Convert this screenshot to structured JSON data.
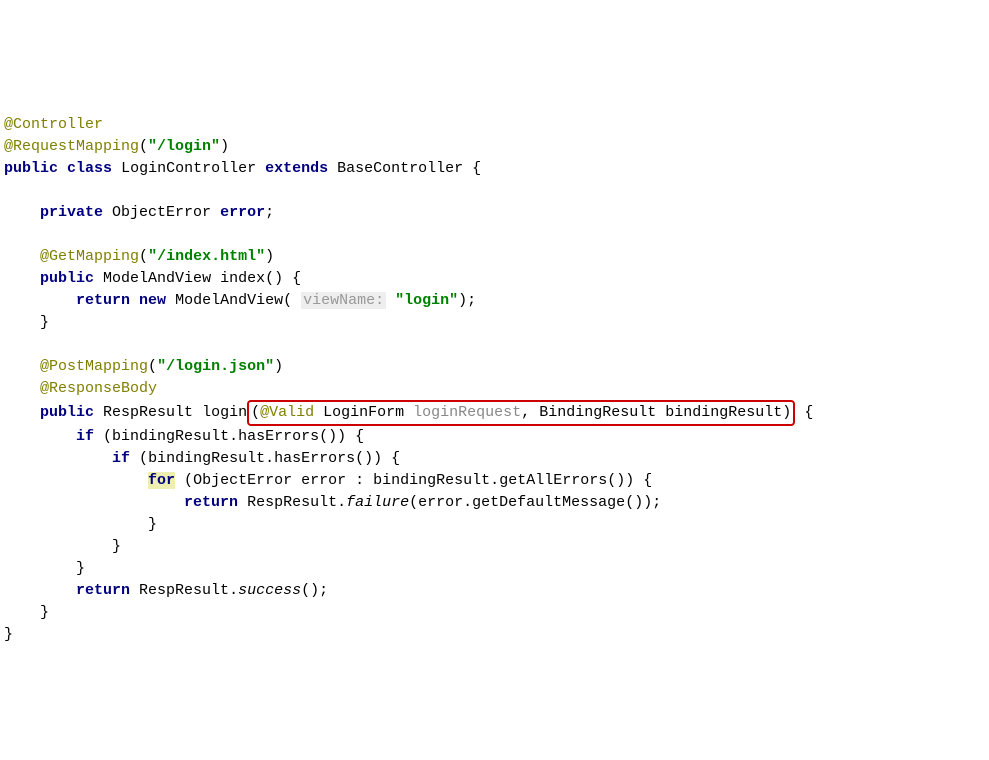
{
  "lines": {
    "at_controller": "@Controller",
    "at_requestmapping": "@RequestMapping",
    "login_path": "\"/login\"",
    "public": "public",
    "class_kw": "class",
    "extends_kw": "extends",
    "private_kw": "private",
    "return_kw": "return",
    "new_kw": "new",
    "if_kw": "if",
    "for_kw": "for",
    "login_controller": "LoginController",
    "base_controller": "BaseController",
    "object_error": "ObjectError",
    "error_field": "error",
    "at_getmapping": "@GetMapping",
    "index_path": "\"/index.html\"",
    "model_and_view": "ModelAndView",
    "index_method": "index",
    "viewname_hint": "viewName:",
    "login_str": "\"login\"",
    "at_postmapping": "@PostMapping",
    "login_json": "\"/login.json\"",
    "at_responsebody": "@ResponseBody",
    "resp_result": "RespResult",
    "login_method": "login",
    "at_valid": "@Valid",
    "login_form": "LoginForm",
    "login_request": "loginRequest",
    "binding_result": "BindingResult",
    "binding_result_var": "bindingResult",
    "has_errors": "hasErrors",
    "error_var": "error",
    "get_all_errors": "getAllErrors",
    "failure": "failure",
    "get_default_message": "getDefaultMessage",
    "success": "success"
  }
}
